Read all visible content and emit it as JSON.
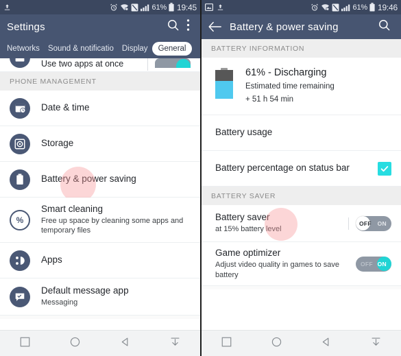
{
  "left": {
    "statusbar": {
      "icons": [
        "upload-icon"
      ],
      "right_icons": [
        "alarm-icon",
        "wifi-lock-icon",
        "sync-off-icon",
        "signal-icon"
      ],
      "battery_percent": "61%",
      "clock": "19:45"
    },
    "appbar": {
      "title": "Settings",
      "actions": [
        "search-icon",
        "overflow-menu-icon"
      ]
    },
    "tabs": [
      {
        "label": "Networks",
        "selected": false
      },
      {
        "label": "Sound & notificatio",
        "selected": false
      },
      {
        "label": "Display",
        "selected": false
      },
      {
        "label": "General",
        "selected": true
      }
    ],
    "clipped_row": {
      "title": "Use two apps at once",
      "toggle": "ON"
    },
    "section_header": "PHONE MANAGEMENT",
    "rows": [
      {
        "icon": "date-time-icon",
        "title": "Date & time",
        "subtitle": ""
      },
      {
        "icon": "storage-icon",
        "title": "Storage",
        "subtitle": ""
      },
      {
        "icon": "battery-icon",
        "title": "Battery & power saving",
        "subtitle": ""
      },
      {
        "icon": "smart-cleaning-icon",
        "title": "Smart cleaning",
        "subtitle": "Free up space by cleaning some apps and temporary files"
      },
      {
        "icon": "apps-icon",
        "title": "Apps",
        "subtitle": ""
      },
      {
        "icon": "message-app-icon",
        "title": "Default message app",
        "subtitle": "Messaging"
      }
    ]
  },
  "right": {
    "statusbar": {
      "left_icons": [
        "image-icon",
        "upload-icon"
      ],
      "right_icons": [
        "alarm-icon",
        "wifi-lock-icon",
        "sync-off-icon",
        "signal-icon"
      ],
      "battery_percent": "61%",
      "clock": "19:46"
    },
    "appbar": {
      "back": "back-arrow-icon",
      "title": "Battery & power saving",
      "actions": [
        "search-icon"
      ]
    },
    "section_battery_information": "BATTERY INFORMATION",
    "battery": {
      "status": "61% - Discharging",
      "estimate_label": "Estimated time remaining",
      "estimate_value": "+ 51 h 54 min",
      "charge_percent": 61
    },
    "battery_usage_row": "Battery usage",
    "percentage_row": {
      "title": "Battery percentage on status bar",
      "checked": true
    },
    "section_battery_saver": "BATTERY SAVER",
    "saver_rows": [
      {
        "title": "Battery saver",
        "subtitle": "at 15% battery level",
        "state": "OFF",
        "off_label": "OFF",
        "on_label": "ON"
      },
      {
        "title": "Game optimizer",
        "subtitle": "Adjust video quality in games to save battery",
        "state": "ON",
        "off_label": "OFF",
        "on_label": "ON"
      }
    ]
  },
  "navbar": {
    "buttons": [
      "recents-icon",
      "home-icon",
      "back-icon",
      "hide-keyboard-icon"
    ]
  },
  "colors": {
    "appbar": "#475571",
    "statusbar": "#3b475f",
    "accent_cyan": "#21d4d4",
    "battery_fill": "#4fc9ef",
    "tap_indicator": "#f79496"
  }
}
